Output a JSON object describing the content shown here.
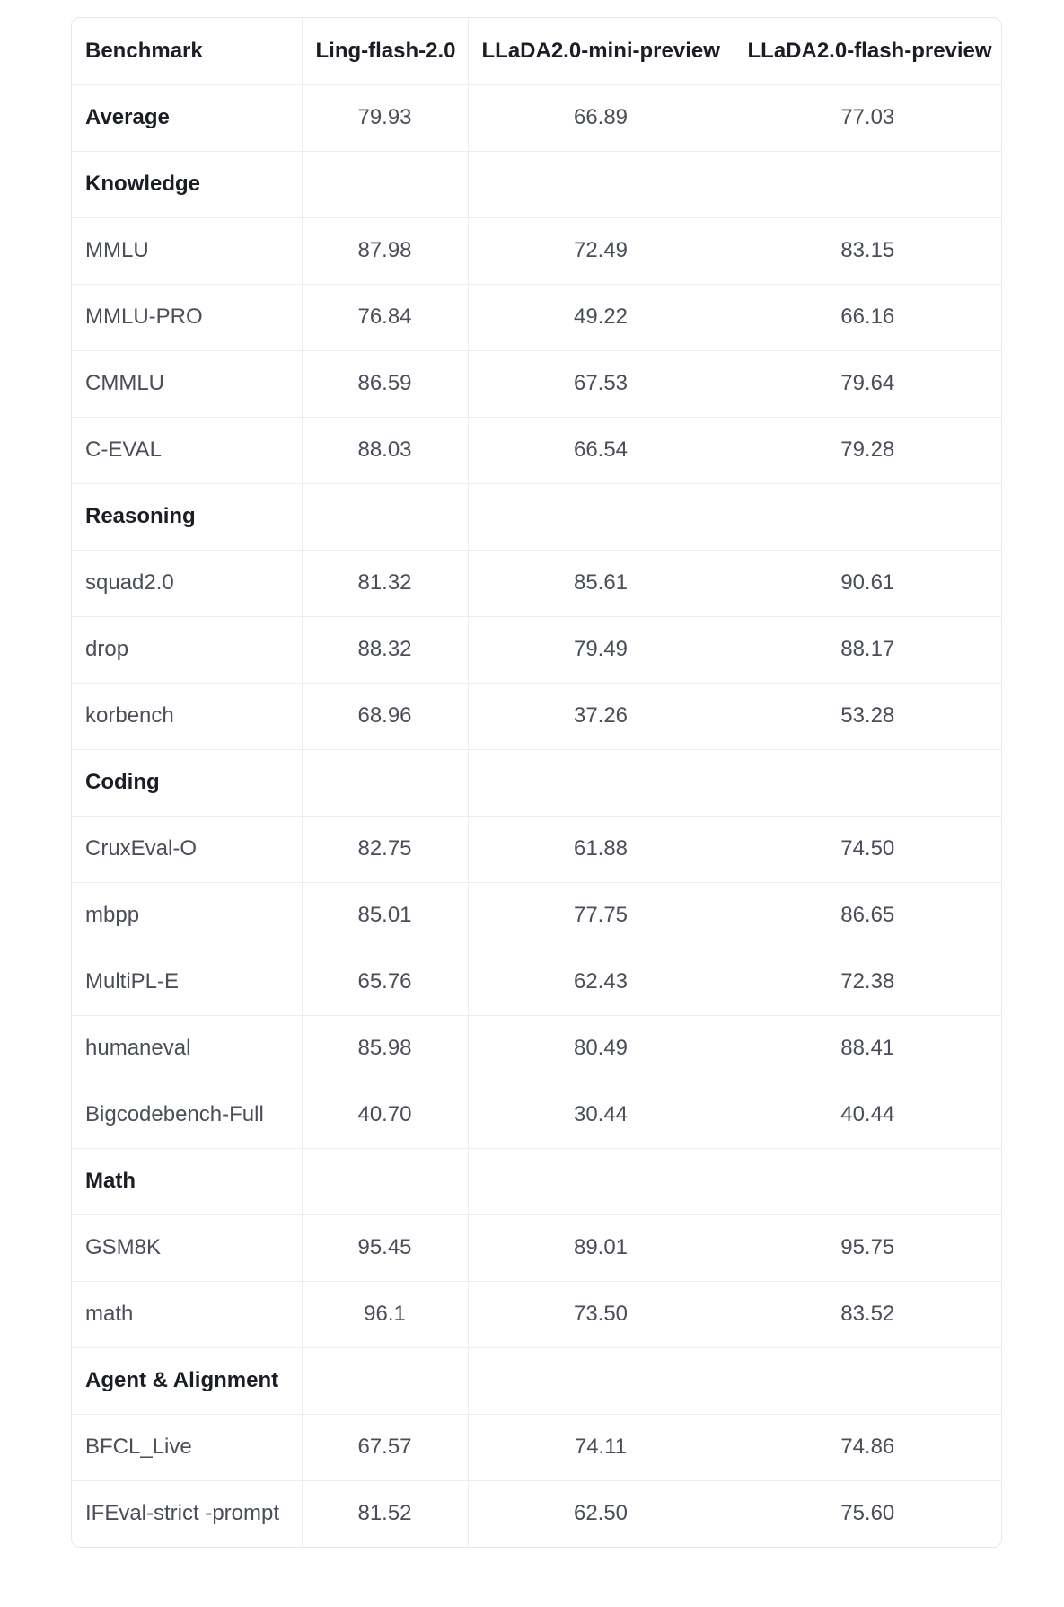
{
  "table": {
    "headers": [
      "Benchmark",
      "Ling-flash-2.0",
      "LLaDA2.0-mini-preview",
      "LLaDA2.0-flash-preview"
    ],
    "rows": [
      {
        "type": "avg",
        "cells": [
          "Average",
          "79.93",
          "66.89",
          "77.03"
        ]
      },
      {
        "type": "section",
        "cells": [
          "Knowledge",
          "",
          "",
          ""
        ]
      },
      {
        "type": "data",
        "cells": [
          "MMLU",
          "87.98",
          "72.49",
          "83.15"
        ]
      },
      {
        "type": "data",
        "cells": [
          "MMLU-PRO",
          "76.84",
          "49.22",
          "66.16"
        ]
      },
      {
        "type": "data",
        "cells": [
          "CMMLU",
          "86.59",
          "67.53",
          "79.64"
        ]
      },
      {
        "type": "data",
        "cells": [
          "C-EVAL",
          "88.03",
          "66.54",
          "79.28"
        ]
      },
      {
        "type": "section",
        "cells": [
          "Reasoning",
          "",
          "",
          ""
        ]
      },
      {
        "type": "data",
        "cells": [
          "squad2.0",
          "81.32",
          "85.61",
          "90.61"
        ]
      },
      {
        "type": "data",
        "cells": [
          "drop",
          "88.32",
          "79.49",
          "88.17"
        ]
      },
      {
        "type": "data",
        "cells": [
          "korbench",
          "68.96",
          "37.26",
          "53.28"
        ]
      },
      {
        "type": "section",
        "cells": [
          "Coding",
          "",
          "",
          ""
        ]
      },
      {
        "type": "data",
        "cells": [
          "CruxEval-O",
          "82.75",
          "61.88",
          "74.50"
        ]
      },
      {
        "type": "data",
        "cells": [
          "mbpp",
          "85.01",
          "77.75",
          "86.65"
        ]
      },
      {
        "type": "data",
        "cells": [
          "MultiPL-E",
          "65.76",
          "62.43",
          "72.38"
        ]
      },
      {
        "type": "data",
        "cells": [
          "humaneval",
          "85.98",
          "80.49",
          "88.41"
        ]
      },
      {
        "type": "data",
        "cells": [
          "Bigcodebench-Full",
          "40.70",
          "30.44",
          "40.44"
        ]
      },
      {
        "type": "section",
        "cells": [
          "Math",
          "",
          "",
          ""
        ]
      },
      {
        "type": "data",
        "cells": [
          "GSM8K",
          "95.45",
          "89.01",
          "95.75"
        ]
      },
      {
        "type": "data",
        "cells": [
          "math",
          "96.1",
          "73.50",
          "83.52"
        ]
      },
      {
        "type": "section",
        "cells": [
          "Agent & Alignment",
          "",
          "",
          ""
        ]
      },
      {
        "type": "data",
        "cells": [
          "BFCL_Live",
          "67.57",
          "74.11",
          "74.86"
        ]
      },
      {
        "type": "data",
        "cells": [
          "IFEval-strict -prompt",
          "81.52",
          "62.50",
          "75.60"
        ]
      }
    ]
  }
}
